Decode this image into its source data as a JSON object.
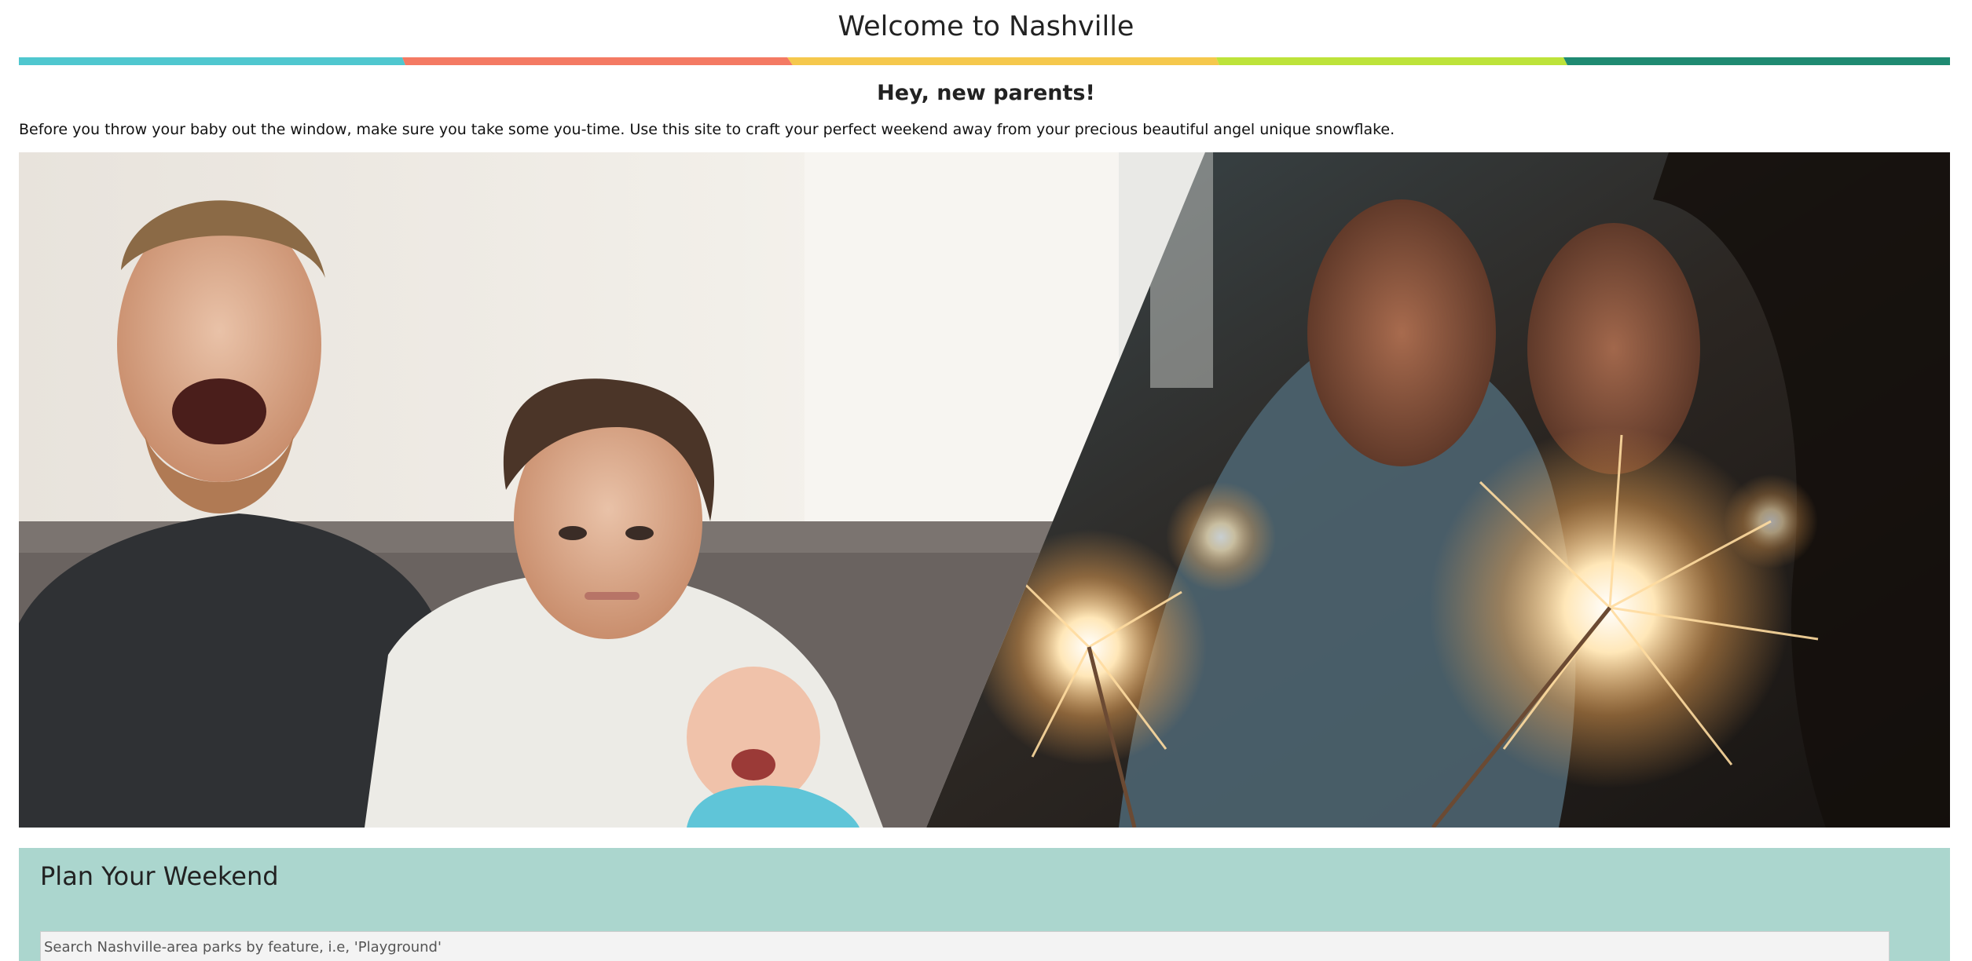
{
  "header": {
    "title": "Welcome to Nashville"
  },
  "colors": {
    "rainbow": [
      "#4fc7cf",
      "#f47a63",
      "#f5c84c",
      "#bde33a",
      "#1f8a72"
    ],
    "panel": "#abd6ce"
  },
  "hero": {
    "subtitle": "Hey, new parents!",
    "intro": "Before you throw your baby out the window, make sure you take some you-time. Use this site to craft your perfect weekend away from your precious beautiful angel unique snowflake.",
    "image_left": "exhausted-parents-with-crying-baby-photo",
    "image_right": "couple-kissing-with-sparklers-photo"
  },
  "plan": {
    "title": "Plan Your Weekend",
    "search_placeholder": "Search Nashville-area parks by feature, i.e, 'Playground'"
  }
}
